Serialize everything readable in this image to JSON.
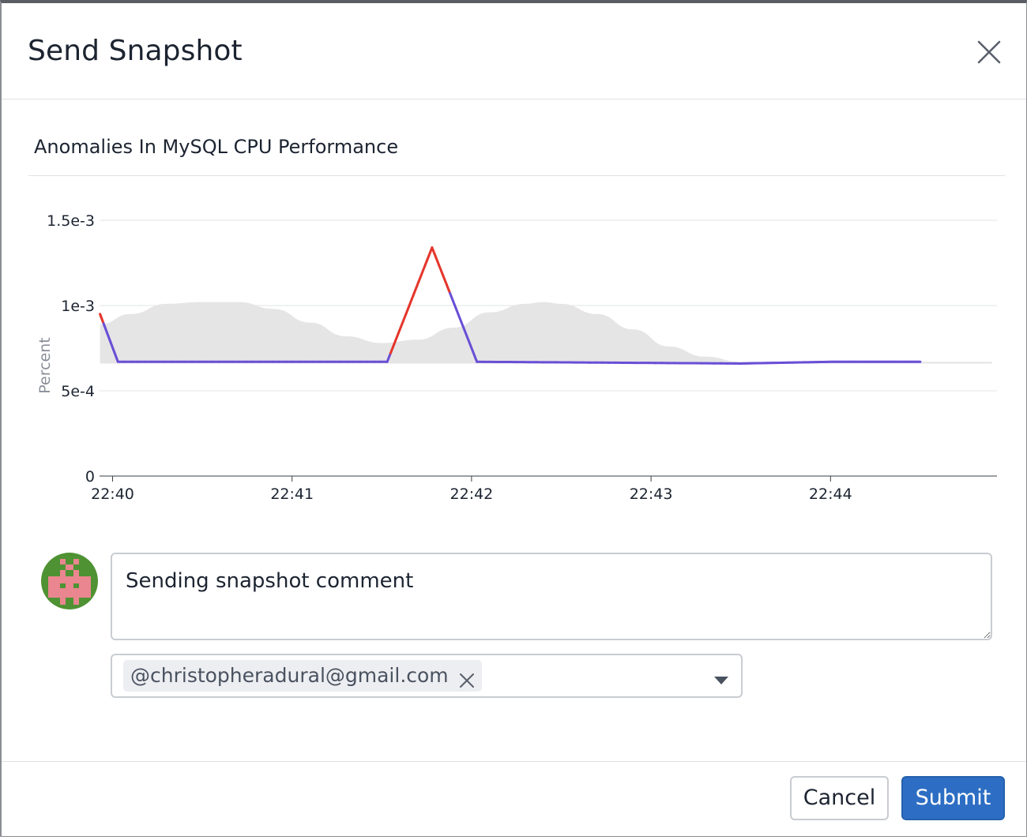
{
  "modal": {
    "title": "Send Snapshot"
  },
  "widget": {
    "title": "Anomalies In MySQL CPU Performance"
  },
  "chart_data": {
    "type": "line",
    "title": "Anomalies In MySQL CPU Performance",
    "ylabel": "Percent",
    "xlabel": "",
    "ylim": [
      0,
      0.0015
    ],
    "xlim": [
      -0.07,
      4.94
    ],
    "y_ticks": [
      {
        "value": 0,
        "label": "0"
      },
      {
        "value": 0.0005,
        "label": "5e-4"
      },
      {
        "value": 0.001,
        "label": "1e-3"
      },
      {
        "value": 0.0015,
        "label": "1.5e-3"
      }
    ],
    "x_ticks": [
      {
        "value": 0,
        "label": "22:40"
      },
      {
        "value": 1,
        "label": "22:41"
      },
      {
        "value": 2,
        "label": "22:42"
      },
      {
        "value": 3,
        "label": "22:43"
      },
      {
        "value": 4,
        "label": "22:44"
      }
    ],
    "x_unit": "minutes after 22:40",
    "grid": true,
    "band": {
      "upper": [
        [
          -0.07,
          0.00089
        ],
        [
          0.1,
          0.00095
        ],
        [
          0.3,
          0.00101
        ],
        [
          0.5,
          0.00102
        ],
        [
          0.7,
          0.00102
        ],
        [
          0.9,
          0.00098
        ],
        [
          1.1,
          0.0009
        ],
        [
          1.3,
          0.00082
        ],
        [
          1.5,
          0.00078
        ],
        [
          1.7,
          0.0008
        ],
        [
          1.9,
          0.00087
        ],
        [
          2.1,
          0.00096
        ],
        [
          2.3,
          0.00101
        ],
        [
          2.4,
          0.00102
        ],
        [
          2.5,
          0.00101
        ],
        [
          2.7,
          0.00095
        ],
        [
          2.9,
          0.00086
        ],
        [
          3.1,
          0.00076
        ],
        [
          3.3,
          0.0007
        ],
        [
          3.5,
          0.00067
        ],
        [
          3.7,
          0.00067
        ],
        [
          4.0,
          0.00067
        ],
        [
          4.3,
          0.00067
        ],
        [
          4.6,
          0.00067
        ],
        [
          4.9,
          0.00067
        ]
      ],
      "lower": [
        [
          -0.07,
          0.00066
        ],
        [
          4.9,
          0.00066
        ]
      ]
    },
    "series": [
      {
        "values": [
          [
            -0.07,
            0.00095
          ],
          [
            0.03,
            0.00067
          ],
          [
            1.53,
            0.00067
          ],
          [
            1.78,
            0.00134
          ],
          [
            2.03,
            0.00067
          ],
          [
            3.5,
            0.00066
          ],
          [
            4.0,
            0.00067
          ],
          [
            4.5,
            0.00067
          ]
        ],
        "colors": {
          "normal": "#6a4fd6",
          "anomaly": "#e5362b"
        }
      }
    ],
    "anomaly_ranges": [
      [
        -0.07,
        -0.05
      ],
      [
        1.55,
        1.88
      ]
    ]
  },
  "comment": {
    "value": "Sending snapshot comment"
  },
  "recipients": {
    "tags": [
      "@christopheradural@gmail.com"
    ]
  },
  "footer": {
    "cancel_label": "Cancel",
    "submit_label": "Submit"
  },
  "colors": {
    "primary": "#2d6ec4",
    "band": "#e5e5e5",
    "line_normal": "#6a4fd6",
    "line_anomaly": "#e5362b",
    "avatar_bg": "#4f9233",
    "avatar_figure": "#e9868f"
  },
  "icons": {
    "close": "close-icon",
    "tag_remove": "close-icon",
    "dropdown": "caret-down-icon"
  }
}
